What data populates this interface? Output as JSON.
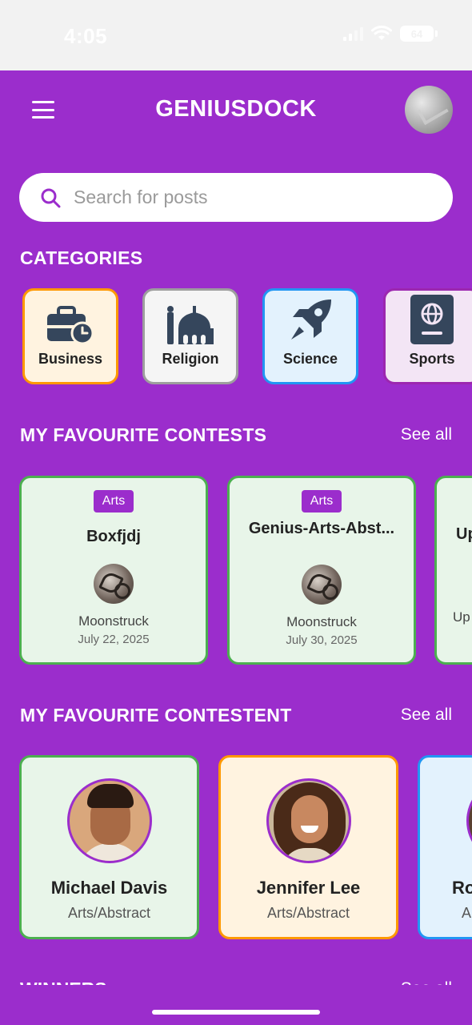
{
  "status_bar": {
    "time": "4:05",
    "battery": "64"
  },
  "header": {
    "title": "GENIUSDOCK"
  },
  "search": {
    "placeholder": "Search for posts"
  },
  "categories": {
    "title": "CATEGORIES",
    "items": [
      {
        "label": "Business",
        "icon": "briefcase-clock-icon",
        "bg": "#fff3e0",
        "border": "#ff9800"
      },
      {
        "label": "Religion",
        "icon": "mosque-icon",
        "bg": "#f5f5f5",
        "border": "#9e9e9e"
      },
      {
        "label": "Science",
        "icon": "rocket-icon",
        "bg": "#e3f2fd",
        "border": "#2196f3"
      },
      {
        "label": "Sports",
        "icon": "passport-icon",
        "bg": "#f3e5f5",
        "border": "#9c27b0"
      }
    ]
  },
  "favourite_contests": {
    "title": "MY FAVOURITE CONTESTS",
    "see_all": "See all",
    "items": [
      {
        "tag": "Arts",
        "title": "Boxfjdj",
        "author": "Moonstruck",
        "date": "July 22, 2025"
      },
      {
        "tag": "Arts",
        "title": "Genius-Arts-Abst...",
        "author": "Moonstruck",
        "date": "July 30, 2025"
      },
      {
        "tag": "",
        "title": "Up",
        "author": "Up",
        "date": ""
      }
    ]
  },
  "favourite_contestant": {
    "title": "MY FAVOURITE CONTESTENT",
    "see_all": "See all",
    "items": [
      {
        "name": "Michael Davis",
        "category": "Arts/Abstract",
        "bg": "#e8f5e9",
        "border": "#4caf50"
      },
      {
        "name": "Jennifer Lee",
        "category": "Arts/Abstract",
        "bg": "#fff3e0",
        "border": "#ff9800"
      },
      {
        "name": "Ro",
        "category": "A",
        "bg": "#e3f2fd",
        "border": "#2196f3"
      }
    ]
  },
  "winners": {
    "title": "WINNERS",
    "see_all": "See all"
  },
  "colors": {
    "primary": "#9b2dcc",
    "surface": "#ffffff"
  }
}
